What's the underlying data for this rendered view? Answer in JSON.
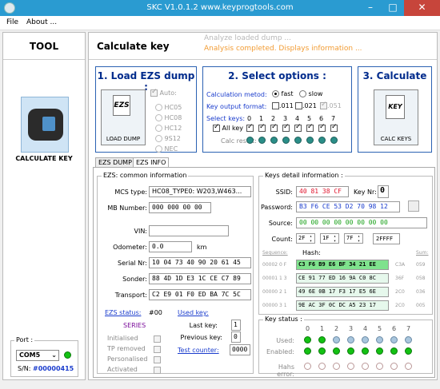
{
  "titlebar": {
    "title": "SKC  V1.0.1.2  www.keyprogtools.com",
    "min": "–",
    "max": "□",
    "close": "✕"
  },
  "menu": {
    "file": "File",
    "about": "About ..."
  },
  "left": {
    "tool_header": "TOOL",
    "calc_label": "CALCULATE KEY",
    "port_label": "Port :",
    "port_value": "COM5",
    "sn_label": "S/N:",
    "sn_value": "#00000415"
  },
  "header": {
    "title": "Calculate key",
    "msg1": "Analyze loaded dump ...",
    "msg2": "Analysis completed. Displays information ..."
  },
  "step1": {
    "title": "1. Load EZS dump :",
    "tile_caption": "LOAD DUMP",
    "tile_glyph": "EZS",
    "auto": "Auto:",
    "options": [
      "HC05",
      "HC08",
      "HC12",
      "9S12",
      "NEC"
    ]
  },
  "step2": {
    "title": "2. Select options :",
    "calc_method_label": "Calculation metod:",
    "fast": "fast",
    "slow": "slow",
    "format_label": "Key output format:",
    "f011": ".011",
    "f021": ".021",
    "f051": ".051",
    "select_keys_label": "Select keys:",
    "all_key": "All key",
    "key_numbers": [
      "0",
      "1",
      "2",
      "3",
      "4",
      "5",
      "6",
      "7"
    ],
    "calc_result_label": "Calc result:"
  },
  "step3": {
    "title": "3. Calculate",
    "tile_caption": "CALC KEYS",
    "tile_glyph": "KEY"
  },
  "tabs": {
    "dump": "EZS DUMP",
    "info": "EZS INFO"
  },
  "ezs_info": {
    "group_label": "EZS: common information",
    "mcs_label": "MCS type:",
    "mcs_value": "HC08_TYPE0: W203,W463...",
    "mb_label": "MB Number:",
    "mb_value": "000 000 00 00",
    "vin_label": "VIN:",
    "vin_value": "",
    "odo_label": "Odometer:",
    "odo_value": "0.0",
    "odo_unit": "km",
    "serial_label": "Serial Nr:",
    "serial_value": "10 04 73 40 90 20 61 45",
    "sonder_label": "Sonder:",
    "sonder_value": "88 4D 1D E3 1C CE C7 89",
    "transport_label": "Transport:",
    "transport_value": "C2 E9 01 F0 ED BA 7C 5C",
    "status_label": "EZS status:",
    "status_value": "#00",
    "series": "SERIES",
    "states": [
      "Initialised",
      "TP removed",
      "Personalised",
      "Activated"
    ],
    "used_key_label": "Used key:",
    "last_key_label": "Last key:",
    "last_key_value": "1",
    "prev_key_label": "Previous key:",
    "prev_key_value": "0",
    "test_counter_label": "Test counter:",
    "test_counter_value": "0000"
  },
  "keys_detail": {
    "group_label": "Keys detail information :",
    "ssid_label": "SSID:",
    "ssid_value": "40 81 38 CF",
    "keynr_label": "Key Nr:",
    "keynr_value": "0",
    "password_label": "Password:",
    "password_value": "B3 F6 CE 53 D2 70 98 12",
    "source_label": "Source:",
    "source_value": "00 00 00 00 00 00 00 00",
    "count_label": "Count:",
    "count_vals": [
      "2F",
      "1F",
      "7F"
    ],
    "count_total": "2FFFF",
    "seq_label": "Sequence:",
    "hash_label": "Hash:",
    "sum_label": "Sum:",
    "rows": [
      {
        "seq": "00002  0  F",
        "hash": "C3 F6 B9 E6 BF 34 21 EE",
        "tag": "C3A",
        "sum": "059"
      },
      {
        "seq": "00001  1  3",
        "hash": "CE 91 77 ED 16 9A C0 8C",
        "tag": "36F",
        "sum": "058"
      },
      {
        "seq": "00000  2  1",
        "hash": "49 6E 0B 17 F3 17 E5 6E",
        "tag": "2C0",
        "sum": "036"
      },
      {
        "seq": "00000  3  1",
        "hash": "9E AC 3F 0C DC A5 23 17",
        "tag": "2C0",
        "sum": "005"
      }
    ]
  },
  "key_status": {
    "group_label": "Key status :",
    "numbers": [
      "0",
      "1",
      "2",
      "3",
      "4",
      "5",
      "6",
      "7"
    ],
    "used_label": "Used:",
    "used": [
      "g",
      "g",
      "b",
      "b",
      "b",
      "b",
      "b",
      "b"
    ],
    "enabled_label": "Enabled:",
    "enabled": [
      "g",
      "g",
      "g",
      "g",
      "g",
      "g",
      "g",
      "g"
    ],
    "hash_error_label": "Hahs error:"
  }
}
